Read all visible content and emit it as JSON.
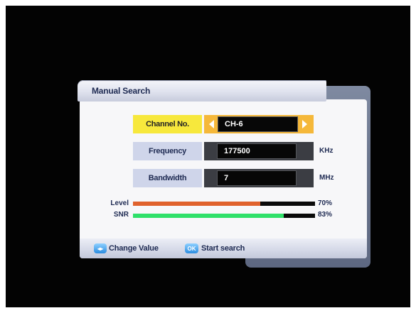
{
  "dialog": {
    "title": "Manual Search"
  },
  "fields": [
    {
      "label": "Channel No.",
      "value": "CH-6",
      "unit": "",
      "selected": true
    },
    {
      "label": "Frequency",
      "value": "177500",
      "unit": "KHz",
      "selected": false
    },
    {
      "label": "Bandwidth",
      "value": "7",
      "unit": "MHz",
      "selected": false
    }
  ],
  "meters": [
    {
      "label": "Level",
      "value_percent": 70,
      "text": "70%",
      "color": "#e0622d"
    },
    {
      "label": "SNR",
      "value_percent": 83,
      "text": "83%",
      "color": "#2fe06a"
    }
  ],
  "footer": {
    "change_key_icon": "left-right-arrows-icon",
    "change_label": "Change Value",
    "ok_key": "OK",
    "ok_label": "Start search"
  },
  "colors": {
    "selected_label": "#f7e83c",
    "selected_value_bg": "#f5b83a",
    "label_bg": "#cfd5ea",
    "key_blue": "#2b8de0"
  }
}
